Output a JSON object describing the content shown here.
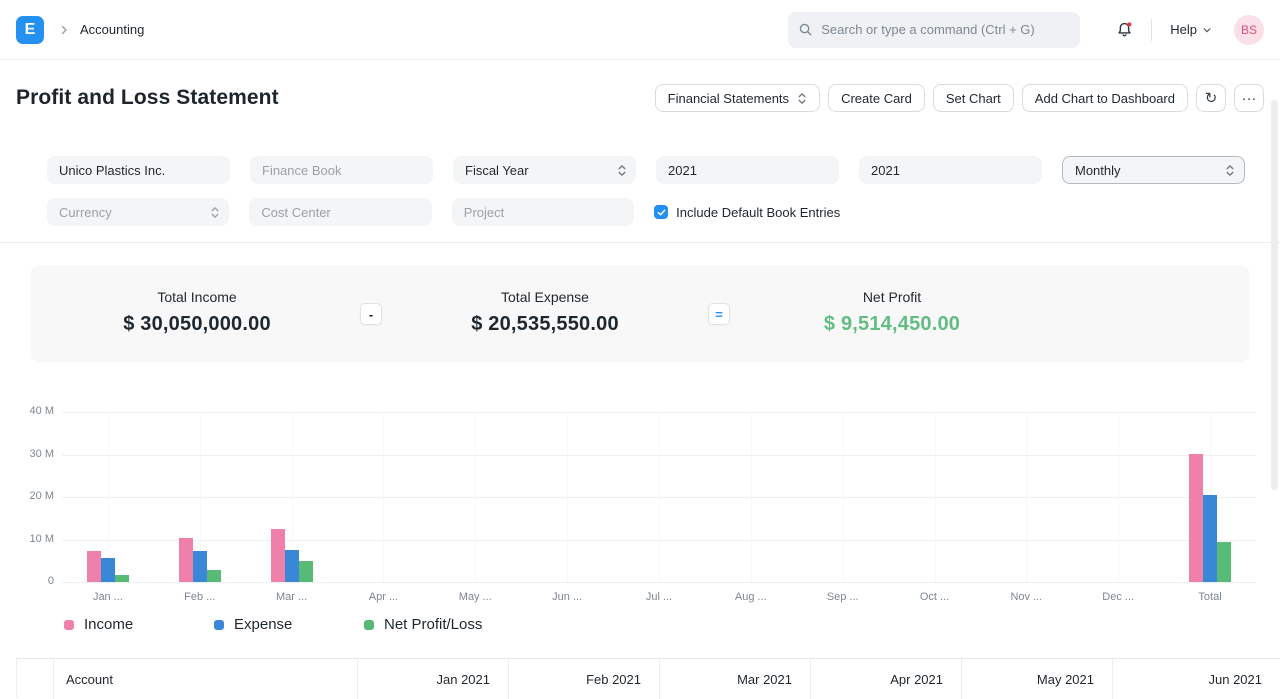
{
  "navbar": {
    "logo_letter": "E",
    "breadcrumb": "Accounting",
    "search": {
      "placeholder": "Search or type a command (Ctrl + G)"
    },
    "help_label": "Help",
    "avatar_initials": "BS",
    "notification_unread": true
  },
  "page_head": {
    "title": "Profit and Loss Statement",
    "buttons": {
      "financial_statements": "Financial Statements",
      "create_card": "Create Card",
      "set_chart": "Set Chart",
      "add_chart_to_dashboard": "Add Chart to Dashboard"
    }
  },
  "icons": {
    "menu_ellipsis": "···",
    "refresh": "↻",
    "names": [
      "app-logo",
      "breadcrumb-chevron-icon",
      "search-icon",
      "bell-icon",
      "notification-dot",
      "help-chevron-icon",
      "select-chevrons-icon",
      "refresh-icon",
      "menu-ellipsis-icon",
      "checkbox-check-icon"
    ]
  },
  "filters": {
    "company": "Unico Plastics Inc.",
    "finance_book_placeholder": "Finance Book",
    "period_basis": "Fiscal Year",
    "start_year": "2021",
    "end_year": "2021",
    "periodicity": "Monthly",
    "currency_placeholder": "Currency",
    "cost_center_placeholder": "Cost Center",
    "project_placeholder": "Project",
    "include_default_book_entries_label": "Include Default Book Entries",
    "include_default_book_entries_checked": true
  },
  "summary": {
    "total_income": {
      "label": "Total Income",
      "value": "$ 30,050,000.00"
    },
    "operator_minus": "-",
    "total_expense": {
      "label": "Total Expense",
      "value": "$ 20,535,550.00"
    },
    "operator_equals": "=",
    "net_profit": {
      "label": "Net Profit",
      "value": "$ 9,514,450.00"
    }
  },
  "chart_data": {
    "type": "bar",
    "categories": [
      "Jan ...",
      "Feb ...",
      "Mar ...",
      "Apr ...",
      "May ...",
      "Jun ...",
      "Jul ...",
      "Aug ...",
      "Sep ...",
      "Oct ...",
      "Nov ...",
      "Dec ...",
      "Total"
    ],
    "series": [
      {
        "name": "Income",
        "color": "#ef7fab",
        "values": [
          7300000,
          10300000,
          12450000,
          0,
          0,
          0,
          0,
          0,
          0,
          0,
          0,
          0,
          30050000
        ]
      },
      {
        "name": "Expense",
        "color": "#3a87d8",
        "values": [
          5600000,
          7400000,
          7535550,
          0,
          0,
          0,
          0,
          0,
          0,
          0,
          0,
          0,
          20535550
        ]
      },
      {
        "name": "Net Profit/Loss",
        "color": "#57bb77",
        "values": [
          1700000,
          2900000,
          4914450,
          0,
          0,
          0,
          0,
          0,
          0,
          0,
          0,
          0,
          9514450
        ]
      }
    ],
    "title": "",
    "xlabel": "",
    "ylabel": "",
    "ylim": [
      0,
      40000000
    ],
    "y_ticks": [
      "40 M",
      "30 M",
      "20 M",
      "10 M",
      "0"
    ],
    "grid": true,
    "legend_position": "bottom"
  },
  "table": {
    "columns": [
      "Account",
      "Jan 2021",
      "Feb 2021",
      "Mar 2021",
      "Apr 2021",
      "May 2021",
      "Jun 2021"
    ]
  }
}
